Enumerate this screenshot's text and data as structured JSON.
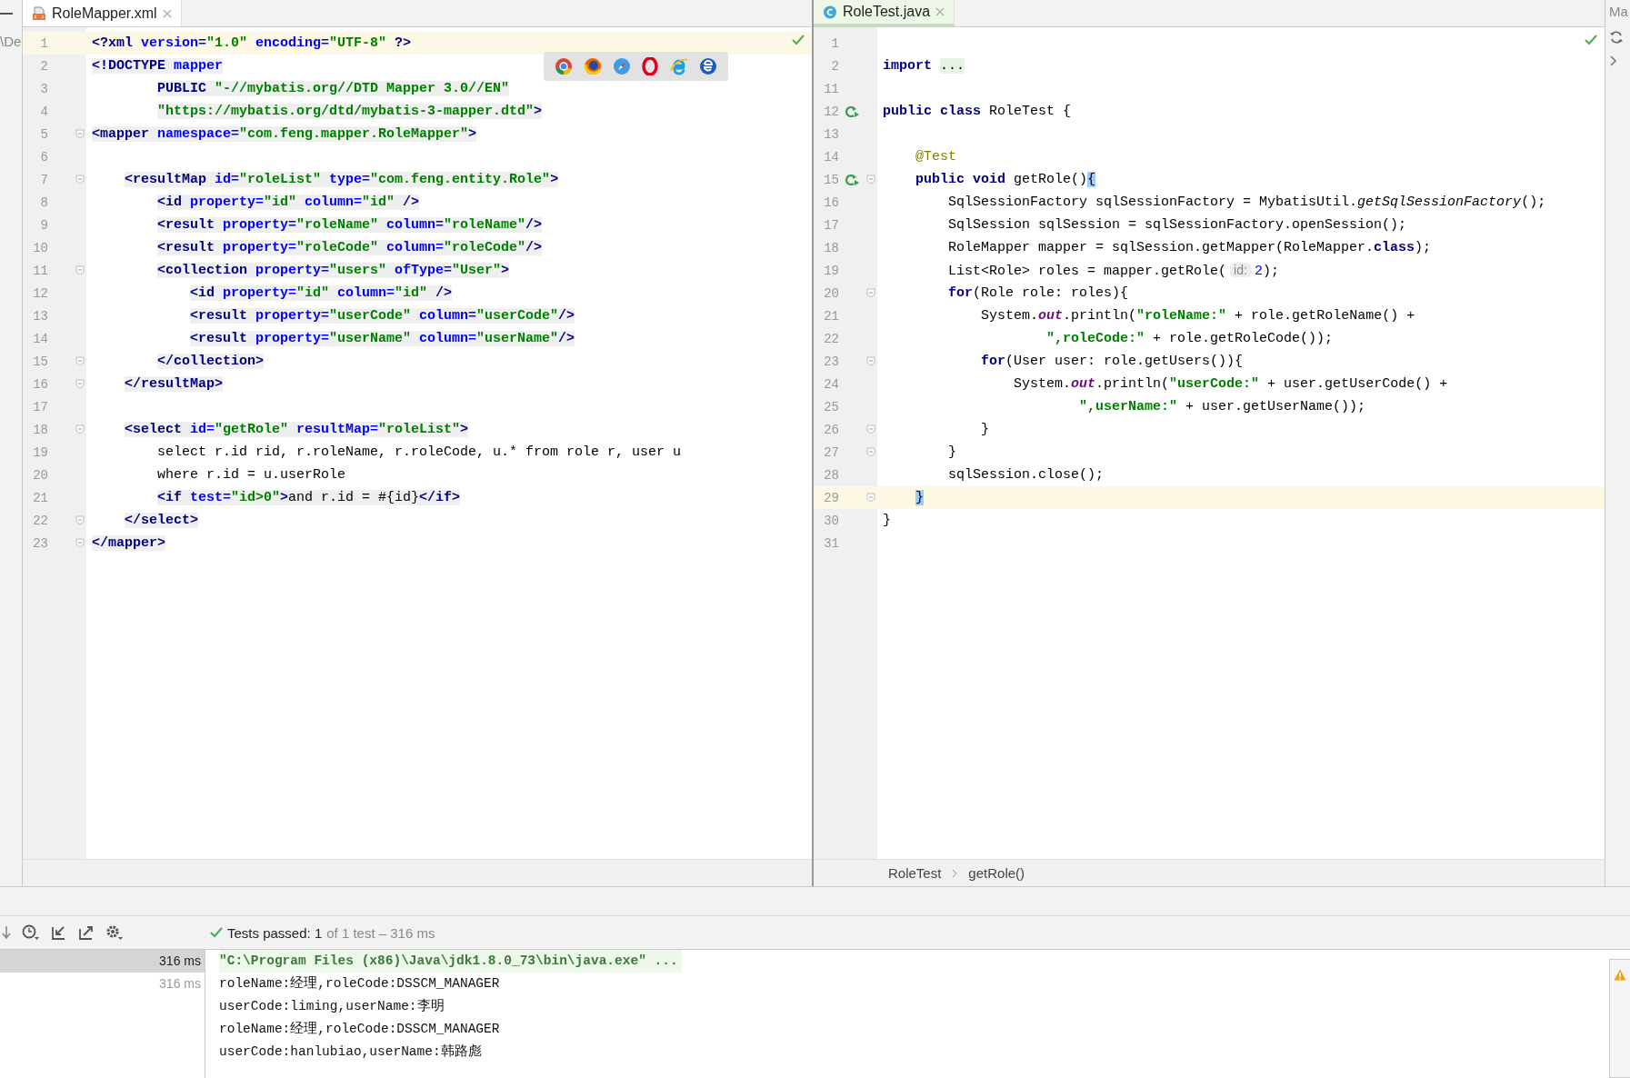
{
  "left_strip": {
    "text": "\\De"
  },
  "left_editor": {
    "tab": {
      "label": "RoleMapper.xml"
    },
    "lines": [
      {
        "no": "1",
        "fold": false,
        "shaded": false,
        "current": true,
        "tokens": [
          {
            "kind": "tag",
            "text": "<?xml"
          },
          {
            "kind": "attr",
            "text": " version="
          },
          {
            "kind": "str",
            "text": "\"1.0\""
          },
          {
            "kind": "attr",
            "text": " encoding="
          },
          {
            "kind": "str",
            "text": "\"UTF-8\""
          },
          {
            "kind": "tag",
            "text": " ?>"
          }
        ]
      },
      {
        "no": "2",
        "fold": false,
        "shaded": true,
        "current": false,
        "tokens": [
          {
            "kind": "tag",
            "text": "<!DOCTYPE"
          },
          {
            "kind": "attr",
            "text": " mapper"
          }
        ]
      },
      {
        "no": "3",
        "fold": false,
        "shaded": true,
        "current": false,
        "tokens": [
          {
            "kind": "tag",
            "text": "        PUBLIC "
          },
          {
            "kind": "str",
            "text": "\"-//mybatis.org//DTD Mapper 3.0//EN\""
          }
        ]
      },
      {
        "no": "4",
        "fold": false,
        "shaded": true,
        "current": false,
        "tokens": [
          {
            "kind": "str",
            "text": "        \"https://mybatis.org/dtd/mybatis-3-mapper.dtd\""
          },
          {
            "kind": "tag",
            "text": ">"
          }
        ]
      },
      {
        "no": "5",
        "fold": true,
        "shaded": true,
        "current": false,
        "tokens": [
          {
            "kind": "tag",
            "text": "<mapper"
          },
          {
            "kind": "attr",
            "text": " namespace="
          },
          {
            "kind": "str",
            "text": "\"com.feng.mapper.RoleMapper\""
          },
          {
            "kind": "tag",
            "text": ">"
          }
        ]
      },
      {
        "no": "6",
        "fold": false,
        "current": false
      },
      {
        "no": "7",
        "fold": true,
        "shaded": true,
        "current": false,
        "tokens": [
          {
            "kind": "tag",
            "text": "    <resultMap"
          },
          {
            "kind": "attr",
            "text": " id="
          },
          {
            "kind": "str",
            "text": "\"roleList\""
          },
          {
            "kind": "attr",
            "text": " type="
          },
          {
            "kind": "str",
            "text": "\"com.feng.entity.Role\""
          },
          {
            "kind": "tag",
            "text": ">"
          }
        ]
      },
      {
        "no": "8",
        "fold": false,
        "shaded": true,
        "current": false,
        "tokens": [
          {
            "kind": "tag",
            "text": "        <id"
          },
          {
            "kind": "attr",
            "text": " property="
          },
          {
            "kind": "str",
            "text": "\"id\""
          },
          {
            "kind": "attr",
            "text": " column="
          },
          {
            "kind": "str",
            "text": "\"id\""
          },
          {
            "kind": "tag",
            "text": " />"
          }
        ]
      },
      {
        "no": "9",
        "fold": false,
        "shaded": true,
        "current": false,
        "tokens": [
          {
            "kind": "tag",
            "text": "        <result"
          },
          {
            "kind": "attr",
            "text": " property="
          },
          {
            "kind": "str",
            "text": "\"roleName\""
          },
          {
            "kind": "attr",
            "text": " column="
          },
          {
            "kind": "str",
            "text": "\"roleName\""
          },
          {
            "kind": "tag",
            "text": "/>"
          }
        ]
      },
      {
        "no": "10",
        "fold": false,
        "shaded": true,
        "current": false,
        "tokens": [
          {
            "kind": "tag",
            "text": "        <result"
          },
          {
            "kind": "attr",
            "text": " property="
          },
          {
            "kind": "str",
            "text": "\"roleCode\""
          },
          {
            "kind": "attr",
            "text": " column="
          },
          {
            "kind": "str",
            "text": "\"roleCode\""
          },
          {
            "kind": "tag",
            "text": "/>"
          }
        ]
      },
      {
        "no": "11",
        "fold": true,
        "shaded": true,
        "current": false,
        "tokens": [
          {
            "kind": "tag",
            "text": "        <collection"
          },
          {
            "kind": "attr",
            "text": " property="
          },
          {
            "kind": "str",
            "text": "\"users\""
          },
          {
            "kind": "attr",
            "text": " ofType="
          },
          {
            "kind": "str",
            "text": "\"User\""
          },
          {
            "kind": "tag",
            "text": ">"
          }
        ]
      },
      {
        "no": "12",
        "fold": false,
        "shaded": true,
        "current": false,
        "tokens": [
          {
            "kind": "tag",
            "text": "            <id"
          },
          {
            "kind": "attr",
            "text": " property="
          },
          {
            "kind": "str",
            "text": "\"id\""
          },
          {
            "kind": "attr",
            "text": " column="
          },
          {
            "kind": "str",
            "text": "\"id\""
          },
          {
            "kind": "tag",
            "text": " />"
          }
        ]
      },
      {
        "no": "13",
        "fold": false,
        "shaded": true,
        "current": false,
        "tokens": [
          {
            "kind": "tag",
            "text": "            <result"
          },
          {
            "kind": "attr",
            "text": " property="
          },
          {
            "kind": "str",
            "text": "\"userCode\""
          },
          {
            "kind": "attr",
            "text": " column="
          },
          {
            "kind": "str",
            "text": "\"userCode\""
          },
          {
            "kind": "tag",
            "text": "/>"
          }
        ]
      },
      {
        "no": "14",
        "fold": false,
        "shaded": true,
        "current": false,
        "tokens": [
          {
            "kind": "tag",
            "text": "            <result"
          },
          {
            "kind": "attr",
            "text": " property="
          },
          {
            "kind": "str",
            "text": "\"userName\""
          },
          {
            "kind": "attr",
            "text": " column="
          },
          {
            "kind": "str",
            "text": "\"userName\""
          },
          {
            "kind": "tag",
            "text": "/>"
          }
        ]
      },
      {
        "no": "15",
        "fold": true,
        "shaded": true,
        "current": false,
        "tokens": [
          {
            "kind": "tag",
            "text": "        </collection>"
          }
        ]
      },
      {
        "no": "16",
        "fold": true,
        "shaded": true,
        "current": false,
        "tokens": [
          {
            "kind": "tag",
            "text": "    </resultMap>"
          }
        ]
      },
      {
        "no": "17",
        "fold": false,
        "current": false
      },
      {
        "no": "18",
        "fold": true,
        "shaded": true,
        "current": false,
        "tokens": [
          {
            "kind": "tag",
            "text": "    <select"
          },
          {
            "kind": "attr",
            "text": " id="
          },
          {
            "kind": "str",
            "text": "\"getRole\""
          },
          {
            "kind": "attr",
            "text": " resultMap="
          },
          {
            "kind": "str",
            "text": "\"roleList\""
          },
          {
            "kind": "tag",
            "text": ">"
          }
        ]
      },
      {
        "no": "19",
        "fold": false,
        "shaded": false,
        "current": false,
        "tokens": [
          {
            "kind": "sql",
            "text": "        select r.id rid, r.roleName, r.roleCode, u.* from role r, user u"
          }
        ]
      },
      {
        "no": "20",
        "fold": false,
        "shaded": false,
        "current": false,
        "tokens": [
          {
            "kind": "sql",
            "text": "        where r.id = u.userRole"
          }
        ]
      },
      {
        "no": "21",
        "fold": false,
        "shaded": true,
        "current": false,
        "tokens": [
          {
            "kind": "tag",
            "text": "        <if"
          },
          {
            "kind": "attr",
            "text": " test="
          },
          {
            "kind": "str",
            "text": "\"id>0\""
          },
          {
            "kind": "tag",
            "text": ">"
          },
          {
            "kind": "sql",
            "text": "and r.id = #{id}"
          },
          {
            "kind": "tag",
            "text": "</if>"
          }
        ]
      },
      {
        "no": "22",
        "fold": true,
        "shaded": true,
        "current": false,
        "tokens": [
          {
            "kind": "tag",
            "text": "    </select>"
          }
        ]
      },
      {
        "no": "23",
        "fold": true,
        "shaded": true,
        "current": false,
        "tokens": [
          {
            "kind": "tag",
            "text": "</mapper>"
          }
        ]
      }
    ]
  },
  "right_editor": {
    "tab": {
      "label": "RoleTest.java"
    },
    "lines": [
      {
        "no": "1",
        "fold": false,
        "run": false,
        "current": false
      },
      {
        "no": "2",
        "fold": false,
        "run": false,
        "current": false,
        "tokens": [
          {
            "kind": "kw",
            "text": "import "
          },
          {
            "kind": "folded",
            "text": "..."
          }
        ]
      },
      {
        "no": "11",
        "fold": false,
        "run": false,
        "current": false
      },
      {
        "no": "12",
        "fold": false,
        "run": true,
        "current": false,
        "tokens": [
          {
            "kind": "kw",
            "text": "public class"
          },
          {
            "kind": "plain",
            "text": " RoleTest {"
          }
        ]
      },
      {
        "no": "13",
        "fold": false,
        "run": false,
        "current": false
      },
      {
        "no": "14",
        "fold": false,
        "run": false,
        "current": false,
        "tokens": [
          {
            "kind": "anno",
            "text": "    @Test"
          }
        ]
      },
      {
        "no": "15",
        "fold": true,
        "run": true,
        "current": false,
        "tokens": [
          {
            "kind": "kw",
            "text": "    public void"
          },
          {
            "kind": "plain",
            "text": " getRole()"
          },
          {
            "kind": "brace",
            "text": "{"
          }
        ]
      },
      {
        "no": "16",
        "fold": false,
        "run": false,
        "current": false,
        "tokens": [
          {
            "kind": "plain",
            "text": "        SqlSessionFactory sqlSessionFactory = MybatisUtil."
          },
          {
            "kind": "italic",
            "text": "getSqlSessionFactory"
          },
          {
            "kind": "plain",
            "text": "();"
          }
        ]
      },
      {
        "no": "17",
        "fold": false,
        "run": false,
        "current": false,
        "tokens": [
          {
            "kind": "plain",
            "text": "        SqlSession sqlSession = sqlSessionFactory.openSession();"
          }
        ]
      },
      {
        "no": "18",
        "fold": false,
        "run": false,
        "current": false,
        "tokens": [
          {
            "kind": "plain",
            "text": "        RoleMapper mapper = sqlSession.getMapper(RoleMapper."
          },
          {
            "kind": "kw",
            "text": "class"
          },
          {
            "kind": "plain",
            "text": ");"
          }
        ]
      },
      {
        "no": "19",
        "fold": false,
        "run": false,
        "current": false,
        "tokens": [
          {
            "kind": "plain",
            "text": "        List<Role> roles = mapper.getRole("
          },
          {
            "kind": "hint",
            "text": "id:"
          },
          {
            "kind": "num",
            "text": "2"
          },
          {
            "kind": "plain",
            "text": ");"
          }
        ]
      },
      {
        "no": "20",
        "fold": true,
        "run": false,
        "current": false,
        "tokens": [
          {
            "kind": "kw",
            "text": "        for"
          },
          {
            "kind": "plain",
            "text": "(Role role: roles){"
          }
        ]
      },
      {
        "no": "21",
        "fold": false,
        "run": false,
        "current": false,
        "tokens": [
          {
            "kind": "plain",
            "text": "            System."
          },
          {
            "kind": "field",
            "text": "out"
          },
          {
            "kind": "plain",
            "text": ".println("
          },
          {
            "kind": "str",
            "text": "\"roleName:\""
          },
          {
            "kind": "plain",
            "text": " + role.getRoleName() +"
          }
        ]
      },
      {
        "no": "22",
        "fold": false,
        "run": false,
        "current": false,
        "tokens": [
          {
            "kind": "str",
            "text": "                    \",roleCode:\""
          },
          {
            "kind": "plain",
            "text": " + role.getRoleCode());"
          }
        ]
      },
      {
        "no": "23",
        "fold": true,
        "run": false,
        "current": false,
        "tokens": [
          {
            "kind": "kw",
            "text": "            for"
          },
          {
            "kind": "plain",
            "text": "(User user: role.getUsers()){"
          }
        ]
      },
      {
        "no": "24",
        "fold": false,
        "run": false,
        "current": false,
        "tokens": [
          {
            "kind": "plain",
            "text": "                System."
          },
          {
            "kind": "field",
            "text": "out"
          },
          {
            "kind": "plain",
            "text": ".println("
          },
          {
            "kind": "str",
            "text": "\"userCode:\""
          },
          {
            "kind": "plain",
            "text": " + user.getUserCode() +"
          }
        ]
      },
      {
        "no": "25",
        "fold": false,
        "run": false,
        "current": false,
        "tokens": [
          {
            "kind": "str",
            "text": "                        \",userName:\""
          },
          {
            "kind": "plain",
            "text": " + user.getUserName());"
          }
        ]
      },
      {
        "no": "26",
        "fold": true,
        "run": false,
        "current": false,
        "tokens": [
          {
            "kind": "plain",
            "text": "            }"
          }
        ]
      },
      {
        "no": "27",
        "fold": true,
        "run": false,
        "current": false,
        "tokens": [
          {
            "kind": "plain",
            "text": "        }"
          }
        ]
      },
      {
        "no": "28",
        "fold": false,
        "run": false,
        "current": false,
        "tokens": [
          {
            "kind": "plain",
            "text": "        sqlSession.close();"
          }
        ]
      },
      {
        "no": "29",
        "fold": true,
        "run": false,
        "current": true,
        "tokens": [
          {
            "kind": "brace",
            "text": "    }"
          }
        ]
      },
      {
        "no": "30",
        "fold": false,
        "run": false,
        "current": false,
        "tokens": [
          {
            "kind": "plain",
            "text": "}"
          }
        ]
      },
      {
        "no": "31",
        "fold": false,
        "run": false,
        "current": false
      }
    ],
    "breadcrumbs": [
      "RoleTest",
      "getRole()"
    ]
  },
  "right_strip": {
    "text": "Ma"
  },
  "test_panel": {
    "status": {
      "label": "Tests passed: 1",
      "detail": "of 1 test – 316 ms"
    },
    "tree": [
      {
        "time": "316 ms",
        "selected": true
      },
      {
        "time": "316 ms",
        "selected": false
      }
    ],
    "console": [
      {
        "kind": "command",
        "text": "\"C:\\Program Files (x86)\\Java\\jdk1.8.0_73\\bin\\java.exe\" ..."
      },
      {
        "kind": "output",
        "text": "roleName:经理,roleCode:DSSCM_MANAGER"
      },
      {
        "kind": "output",
        "text": "userCode:liming,userName:李明"
      },
      {
        "kind": "output",
        "text": "roleName:经理,roleCode:DSSCM_MANAGER"
      },
      {
        "kind": "output",
        "text": "userCode:hanlubiao,userName:韩路彪"
      }
    ]
  }
}
